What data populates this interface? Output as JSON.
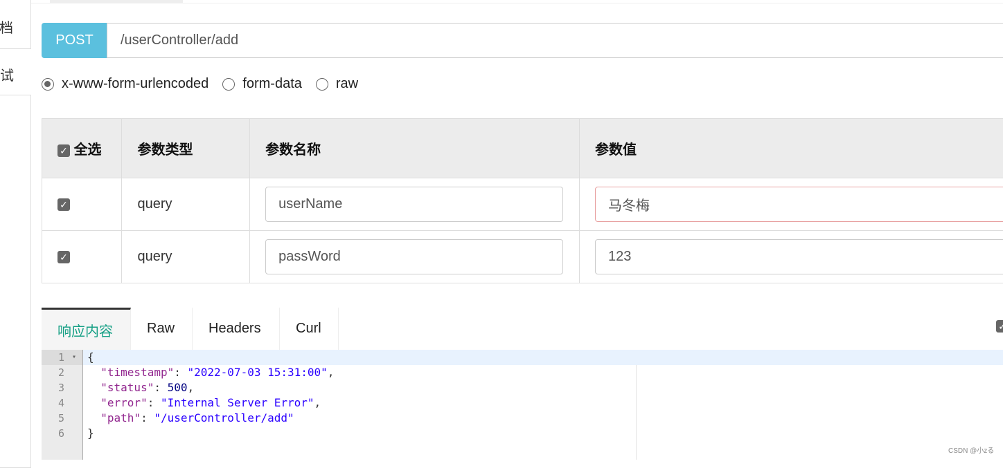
{
  "sidebar": {
    "items": [
      {
        "label": "档"
      },
      {
        "label": "试"
      }
    ]
  },
  "request": {
    "method": "POST",
    "url": "/userController/add"
  },
  "body_types": [
    {
      "label": "x-www-form-urlencoded",
      "selected": true
    },
    {
      "label": "form-data",
      "selected": false
    },
    {
      "label": "raw",
      "selected": false
    }
  ],
  "params_table": {
    "headers": [
      "全选",
      "参数类型",
      "参数名称",
      "参数值"
    ],
    "rows": [
      {
        "checked": true,
        "type": "query",
        "name": "userName",
        "value": "马冬梅"
      },
      {
        "checked": true,
        "type": "query",
        "name": "passWord",
        "value": "123"
      }
    ]
  },
  "response": {
    "tabs": [
      "响应内容",
      "Raw",
      "Headers",
      "Curl"
    ],
    "active_tab": "响应内容",
    "lines": [
      {
        "n": "1",
        "text": "{"
      },
      {
        "n": "2",
        "key": "\"timestamp\"",
        "val": "\"2022-07-03 15:31:00\"",
        "vtype": "s",
        "trail": ","
      },
      {
        "n": "3",
        "key": "\"status\"",
        "val": "500",
        "vtype": "n",
        "trail": ","
      },
      {
        "n": "4",
        "key": "\"error\"",
        "val": "\"Internal Server Error\"",
        "vtype": "s",
        "trail": ","
      },
      {
        "n": "5",
        "key": "\"path\"",
        "val": "\"/userController/add\"",
        "vtype": "s",
        "trail": ""
      },
      {
        "n": "6",
        "text": "}"
      }
    ]
  },
  "watermark": "CSDN @小zる",
  "colors": {
    "method": "#5bc0de",
    "active_tab": "#16a085"
  }
}
